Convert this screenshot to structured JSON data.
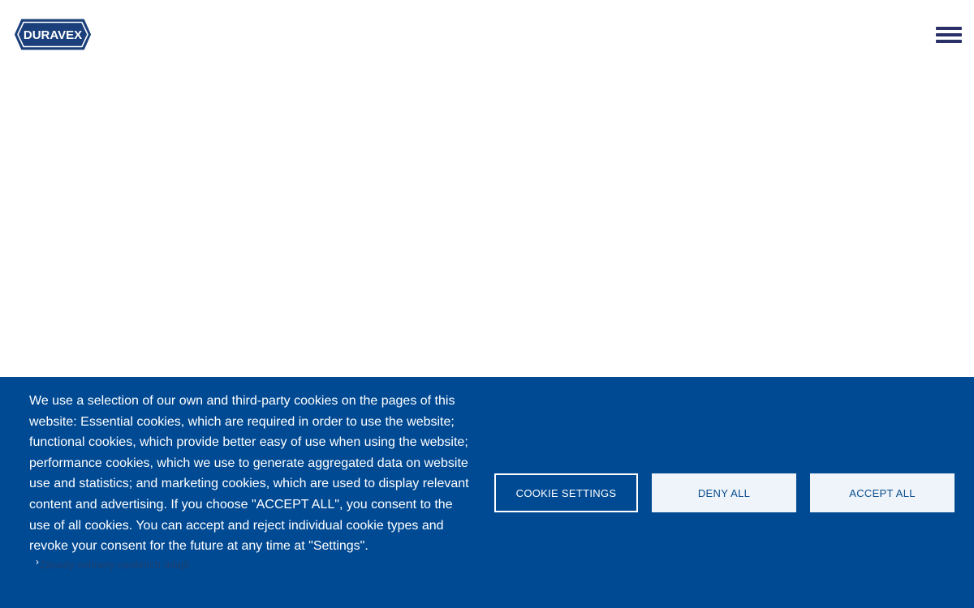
{
  "header": {
    "logo_text": "DURAVEX",
    "menu_icon": "hamburger-menu-icon"
  },
  "colors": {
    "brand": "#004a94",
    "logo_navy": "#1a3f7a",
    "menu_icon": "#2b3068",
    "button_light": "#eef4f9"
  },
  "cookie_banner": {
    "text": "We use a selection of our own and third-party cookies on the pages of this website: Essential cookies, which are required in order to use the website; functional cookies, which provide better easy of use when using the website; performance cookies, which we use to generate aggregated data on website use and statistics; and marketing cookies, which are used to display relevant content and advertising. If you choose \"ACCEPT ALL\", you consent to the use of all cookies. You can accept and reject individual cookie types and revoke your consent for the future at any time at \"Settings\".",
    "privacy_link_label": "Zásady ochrany osobních údajů",
    "privacy_link_icon": "chevron-right-icon",
    "buttons": {
      "settings": "COOKIE SETTINGS",
      "deny": "DENY ALL",
      "accept": "ACCEPT ALL"
    }
  }
}
